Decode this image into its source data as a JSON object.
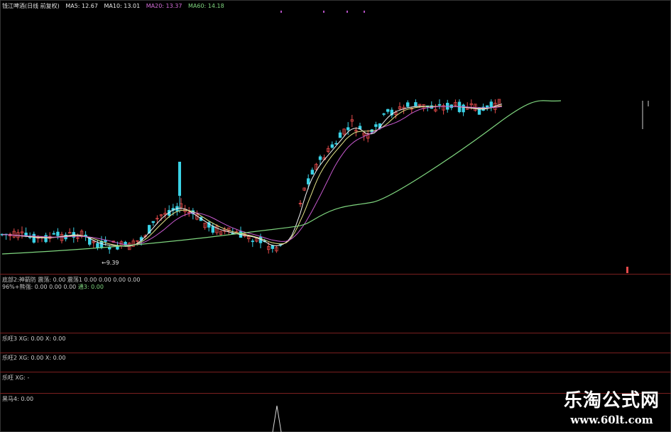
{
  "main": {
    "title": "钱江啤酒(日线 前复权)",
    "ma": [
      {
        "label": "MA5: 12.67",
        "color": "#e8e8e8"
      },
      {
        "label": "MA10: 13.01",
        "color": "#e8e8e8"
      },
      {
        "label": "MA20: 13.37",
        "color": "#d46ed9"
      },
      {
        "label": "MA60: 14.18",
        "color": "#7fd67f"
      }
    ],
    "low_marker": "9.39"
  },
  "indicator": {
    "row1": "底部2:神箭防 震荡: 0.00 震荡1 0.00 0.00 0.00 0.00",
    "row2_prefix": "96%+熊强: 0.00 0.00 0.00",
    "row2_tag": "通3: 0.00"
  },
  "subpanes": [
    {
      "label": "乐旺3 XG: 0.00 X: 0.00"
    },
    {
      "label": "乐旺2 XG: 0.00 X: 0.00"
    },
    {
      "label": "乐旺 XG: -"
    },
    {
      "label": "黑马4: 0.00"
    }
  ],
  "watermark": {
    "title": "乐淘公式网",
    "url": "www.60lt.com"
  },
  "colors": {
    "bg": "#000000",
    "up_candle": "#e64b4b",
    "down_candle": "#3ad2e6",
    "ma5": "#f2f2f2",
    "ma10": "#e6e68a",
    "ma20": "#c85ad0",
    "ma60": "#7fd67f",
    "separator": "#7a1f1f"
  }
}
